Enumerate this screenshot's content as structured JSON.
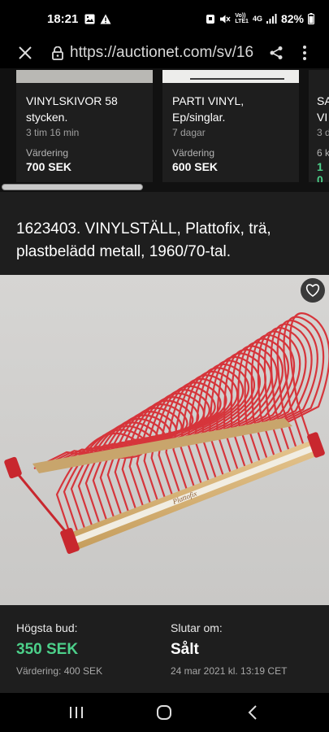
{
  "status": {
    "time": "18:21",
    "network_top": "Vo))",
    "network_bottom": "LTE1",
    "signal_gen": "4G",
    "battery": "82%"
  },
  "browser": {
    "url": "https://auctionet.com/sv/16"
  },
  "carousel": {
    "cards": [
      {
        "title": "VINYLSKIVOR 58 stycken.",
        "time": "3 tim 16 min",
        "valuation_label": "Värdering",
        "valuation": "700 SEK"
      },
      {
        "title": "PARTI VINYL, Ep/singlar.",
        "time": "7 dagar",
        "valuation_label": "Värdering",
        "valuation": "600 SEK"
      },
      {
        "title": "SA VI",
        "time": "3 d",
        "valuation_label": "6 k",
        "valuation": "1 0"
      }
    ]
  },
  "item": {
    "title": "1623403. VINYLSTÄLL, Plattofix, trä, plastbelädd metall, 1960/70-tal.",
    "image_brand_text": "Plattofix"
  },
  "bid": {
    "highest_label": "Högsta bud:",
    "highest_value": "350 SEK",
    "valuation_text": "Värdering: 400 SEK",
    "ends_label": "Slutar om:",
    "ends_value": "Sålt",
    "ends_date": "24 mar 2021 kl. 13:19 CET"
  },
  "colors": {
    "accent_green": "#4cd08a",
    "rack_red": "#d6353b",
    "wood": "#d9b77e"
  }
}
